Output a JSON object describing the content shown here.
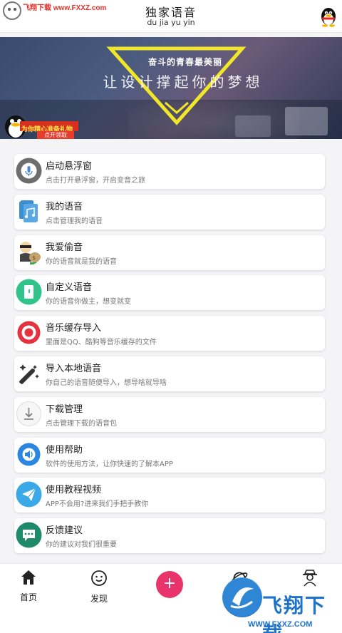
{
  "watermark": {
    "top_text": "飞翔下载 www.FXXZ.com",
    "brand_cn": "飞翔下载",
    "brand_url": "WWW.FXXZ.COM"
  },
  "header": {
    "title": "独家语音",
    "subtitle": "du jia yu yin"
  },
  "banner": {
    "slogan": "奋斗的青春最美丽",
    "headline": "让设计撑起你的梦想",
    "promo_text": "为你精心准备礼物",
    "promo_button": "点开领取"
  },
  "items": [
    {
      "title": "启动悬浮窗",
      "desc": "点击打开悬浮窗，开启变音之旅",
      "icon": "microphone-icon",
      "color": "#6d6d6d"
    },
    {
      "title": "我的语音",
      "desc": "点击管理我的语音",
      "icon": "audio-file-icon",
      "color": "#3d8fd4"
    },
    {
      "title": "我爱偷音",
      "desc": "你的语音就是我的语音",
      "icon": "thief-icon",
      "color": "#c2a26b"
    },
    {
      "title": "自定义语音",
      "desc": "你的语音你做主，想变就变",
      "icon": "custom-voice-icon",
      "color": "#30c48a"
    },
    {
      "title": "音乐缓存导入",
      "desc": "里面是QQ、酷狗等音乐缓存的文件",
      "icon": "music-cache-icon",
      "color": "#e5323f"
    },
    {
      "title": "导入本地语音",
      "desc": "你自己的语音随便导入，想导啥就导啥",
      "icon": "magic-wand-icon",
      "color": "#333333"
    },
    {
      "title": "下载管理",
      "desc": "点击管理下载的语音包",
      "icon": "download-icon",
      "color": "#f2f2f2"
    },
    {
      "title": "使用帮助",
      "desc": "软件的使用方法，让你快速的了解本APP",
      "icon": "help-speaker-icon",
      "color": "#2a86e0"
    },
    {
      "title": "使用教程视频",
      "desc": "APP不会用?进来我们手把手教你",
      "icon": "paper-plane-icon",
      "color": "#3aa9e6"
    },
    {
      "title": "反馈建议",
      "desc": "你的建议对我们很重要",
      "icon": "feedback-icon",
      "color": "#1f8a6a"
    }
  ],
  "nav": {
    "home": "首页",
    "discover": "发现",
    "add": "+"
  }
}
